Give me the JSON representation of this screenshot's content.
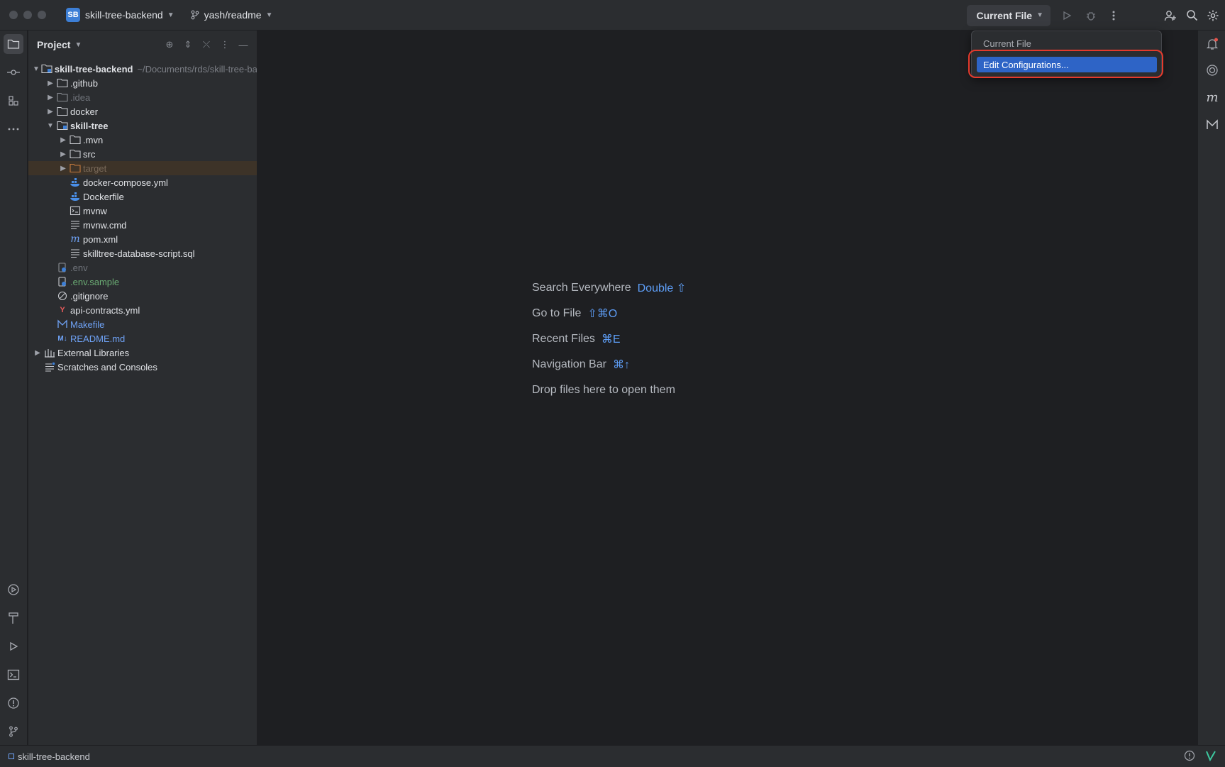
{
  "titlebar": {
    "project_badge": "SB",
    "project_name": "skill-tree-backend",
    "branch": "yash/readme",
    "run_config": "Current File"
  },
  "project_panel": {
    "title": "Project",
    "items": [
      {
        "label": "skill-tree-backend",
        "hint": "~/Documents/rds/skill-tree-backend"
      },
      {
        "label": ".github"
      },
      {
        "label": ".idea"
      },
      {
        "label": "docker"
      },
      {
        "label": "skill-tree"
      },
      {
        "label": ".mvn"
      },
      {
        "label": "src"
      },
      {
        "label": "target"
      },
      {
        "label": "docker-compose.yml"
      },
      {
        "label": "Dockerfile"
      },
      {
        "label": "mvnw"
      },
      {
        "label": "mvnw.cmd"
      },
      {
        "label": "pom.xml"
      },
      {
        "label": "skilltree-database-script.sql"
      },
      {
        "label": ".env"
      },
      {
        "label": ".env.sample"
      },
      {
        "label": ".gitignore"
      },
      {
        "label": "api-contracts.yml"
      },
      {
        "label": "Makefile"
      },
      {
        "label": "README.md"
      },
      {
        "label": "External Libraries"
      },
      {
        "label": "Scratches and Consoles"
      }
    ]
  },
  "editor_hints": [
    {
      "label": "Search Everywhere",
      "key": "Double ⇧"
    },
    {
      "label": "Go to File",
      "key": "⇧⌘O"
    },
    {
      "label": "Recent Files",
      "key": "⌘E"
    },
    {
      "label": "Navigation Bar",
      "key": "⌘↑"
    },
    {
      "label": "Drop files here to open them",
      "key": ""
    }
  ],
  "popup": {
    "items": [
      "Current File",
      "Edit Configurations..."
    ],
    "selected": "Edit Configurations..."
  },
  "statusbar": {
    "project": "skill-tree-backend"
  },
  "colors": {
    "accent": "#2e64c6",
    "annotation": "#e53a2c",
    "background": "#1e1f22",
    "panel": "#2b2d30"
  }
}
